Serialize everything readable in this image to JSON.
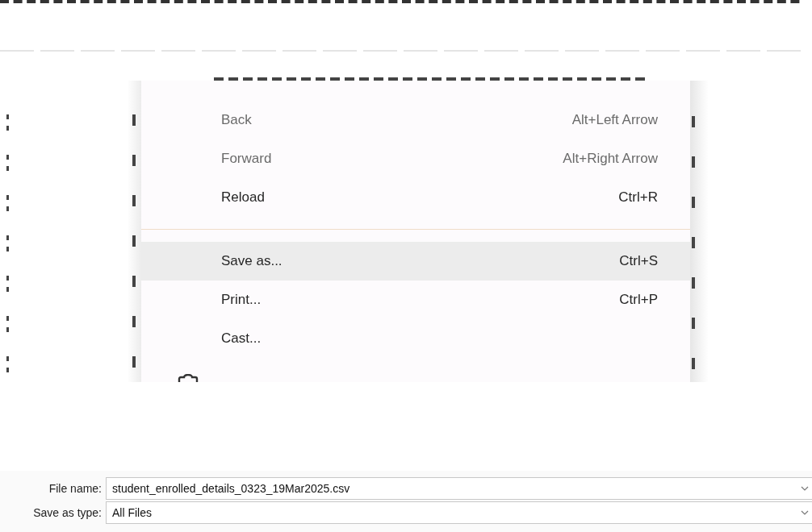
{
  "context_menu": {
    "items": [
      {
        "label": "Back",
        "shortcut": "Alt+Left Arrow",
        "disabled": true,
        "selected": false,
        "divider_after": false
      },
      {
        "label": "Forward",
        "shortcut": "Alt+Right Arrow",
        "disabled": true,
        "selected": false,
        "divider_after": false
      },
      {
        "label": "Reload",
        "shortcut": "Ctrl+R",
        "disabled": false,
        "selected": false,
        "divider_after": true
      },
      {
        "label": "Save as...",
        "shortcut": "Ctrl+S",
        "disabled": false,
        "selected": true,
        "divider_after": false
      },
      {
        "label": "Print...",
        "shortcut": "Ctrl+P",
        "disabled": false,
        "selected": false,
        "divider_after": false
      },
      {
        "label": "Cast...",
        "disabled": false,
        "selected": false,
        "divider_after": false
      }
    ]
  },
  "save_dialog": {
    "fields": [
      {
        "label": "File name:",
        "value": "student_enrolled_details_0323_19Mar2025.csv"
      },
      {
        "label": "Save as type:",
        "value": "All Files"
      }
    ]
  }
}
